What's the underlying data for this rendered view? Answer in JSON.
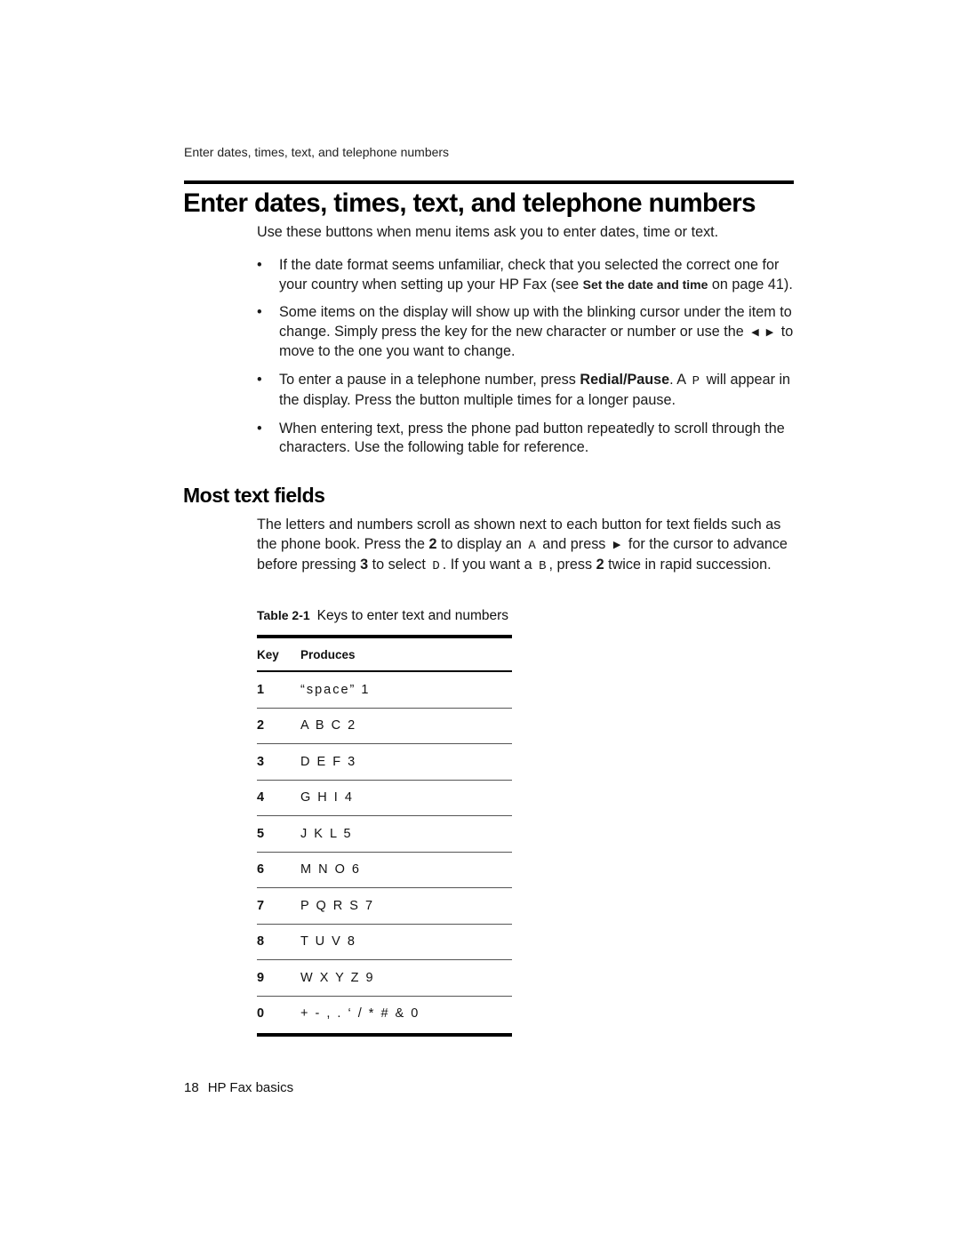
{
  "running_header": "Enter dates, times, text, and telephone numbers",
  "title": "Enter dates, times, text, and telephone numbers",
  "intro": "Use these buttons when menu items ask you to enter dates, time or text.",
  "bullets": [
    {
      "pre": "If the date format seems unfamiliar, check that you selected the correct one for your country when setting up your HP Fax (see ",
      "link": "Set the date and time",
      "post": " on page 41)."
    },
    {
      "pre": "Some items on the display will show up with the blinking cursor under the item to change. Simply press the key for the new character or number or use the",
      "left_arrow": "◀",
      "right_arrow": "▶",
      "post": "to move to the one you want to change."
    },
    {
      "pre": "To enter a pause in a telephone number, press ",
      "bold": "Redial/Pause",
      "mid": ". A ",
      "mono": "P",
      "post": " will appear in the display. Press the button multiple times for a longer pause."
    },
    {
      "text": "When entering text, press the phone pad button repeatedly to scroll through the characters. Use the following table for reference."
    }
  ],
  "section": {
    "heading": "Most text fields",
    "para": {
      "t1": "The letters and numbers scroll as shown next to each button for text fields such as the phone book. Press the ",
      "k1": "2",
      "t2": " to display an ",
      "m1": "A",
      "t3": " and press ",
      "arrow": "▶",
      "t4": " for the cursor to advance before pressing ",
      "k2": "3",
      "t5": " to select ",
      "m2": "D",
      "t6": ". If you want a ",
      "m3": "B",
      "t7": ", press ",
      "k3": "2",
      "t8": " twice in rapid succession."
    }
  },
  "table": {
    "caption_label": "Table 2-1",
    "caption_text": "Keys to enter text and numbers",
    "headers": [
      "Key",
      "Produces"
    ],
    "rows": [
      {
        "key": "1",
        "produces": "“space” 1"
      },
      {
        "key": "2",
        "produces": "A B C 2"
      },
      {
        "key": "3",
        "produces": "D E F 3"
      },
      {
        "key": "4",
        "produces": "G H I 4"
      },
      {
        "key": "5",
        "produces": "J K L 5"
      },
      {
        "key": "6",
        "produces": "M N O 6"
      },
      {
        "key": "7",
        "produces": "P Q R S 7"
      },
      {
        "key": "8",
        "produces": "T U V 8"
      },
      {
        "key": "9",
        "produces": "W X Y Z 9"
      },
      {
        "key": "0",
        "produces": "+ - , . ‘ / * # & 0"
      }
    ]
  },
  "footer": {
    "page_number": "18",
    "chapter": "HP Fax basics"
  }
}
